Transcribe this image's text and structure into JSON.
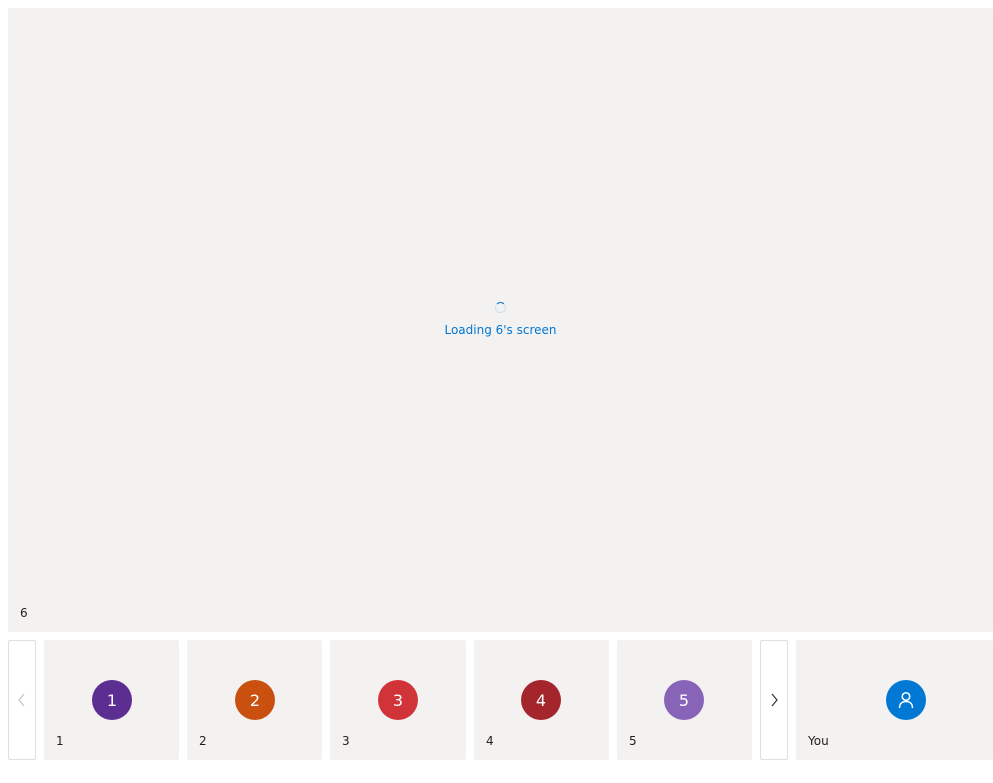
{
  "stage": {
    "loading_text": "Loading 6's screen",
    "participant_name": "6"
  },
  "strip": {
    "prev_icon": "chevron-left-icon",
    "next_icon": "chevron-right-icon",
    "participants": [
      {
        "initial": "1",
        "name": "1",
        "color": "#5c2e91"
      },
      {
        "initial": "2",
        "name": "2",
        "color": "#ca5010"
      },
      {
        "initial": "3",
        "name": "3",
        "color": "#d13438"
      },
      {
        "initial": "4",
        "name": "4",
        "color": "#a4262c"
      },
      {
        "initial": "5",
        "name": "5",
        "color": "#8764b8"
      }
    ],
    "self": {
      "name": "You",
      "icon": "person-icon",
      "color": "#0078d4"
    }
  }
}
